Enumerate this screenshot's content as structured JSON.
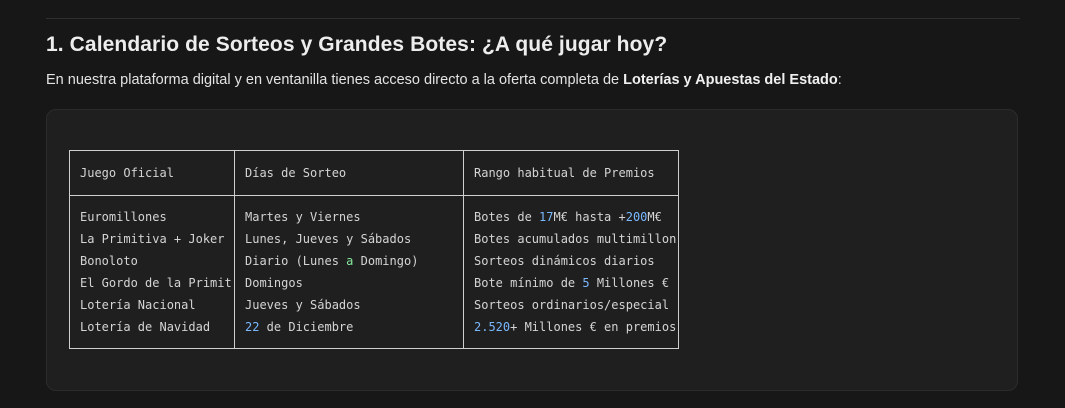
{
  "heading": {
    "title": "1. Calendario de Sorteos y Grandes Botes: ¿A qué jugar hoy?"
  },
  "intro": {
    "text_before": "En nuestra plataforma digital y en ventanilla tienes acceso directo a la oferta completa de ",
    "bold": "Loterías y Apuestas del Estado",
    "text_after": ":"
  },
  "table": {
    "headers": [
      "Juego Oficial",
      "Días de Sorteo",
      "Rango habitual de Premios"
    ],
    "rows": [
      [
        "Euromillones",
        "Martes y Viernes",
        "Botes de 17M€ hasta +200M€"
      ],
      [
        "La Primitiva + Joker",
        "Lunes, Jueves y Sábados",
        "Botes acumulados multimillon"
      ],
      [
        "Bonoloto",
        "Diario (Lunes a Domingo)",
        "Sorteos dinámicos diarios"
      ],
      [
        "El Gordo de la Primit",
        "Domingos",
        "Bote mínimo de 5 Millones €"
      ],
      [
        "Lotería Nacional",
        "Jueves y Sábados",
        "Sorteos ordinarios/especial"
      ],
      [
        "Lotería de Navidad",
        "22 de Diciembre",
        "2.520+ Millones € en premios"
      ]
    ]
  },
  "colors": {
    "background": "#171717",
    "code_block": "#1f1f1f",
    "number_highlight": "#79b8ff",
    "keyword_highlight": "#85e89d"
  }
}
